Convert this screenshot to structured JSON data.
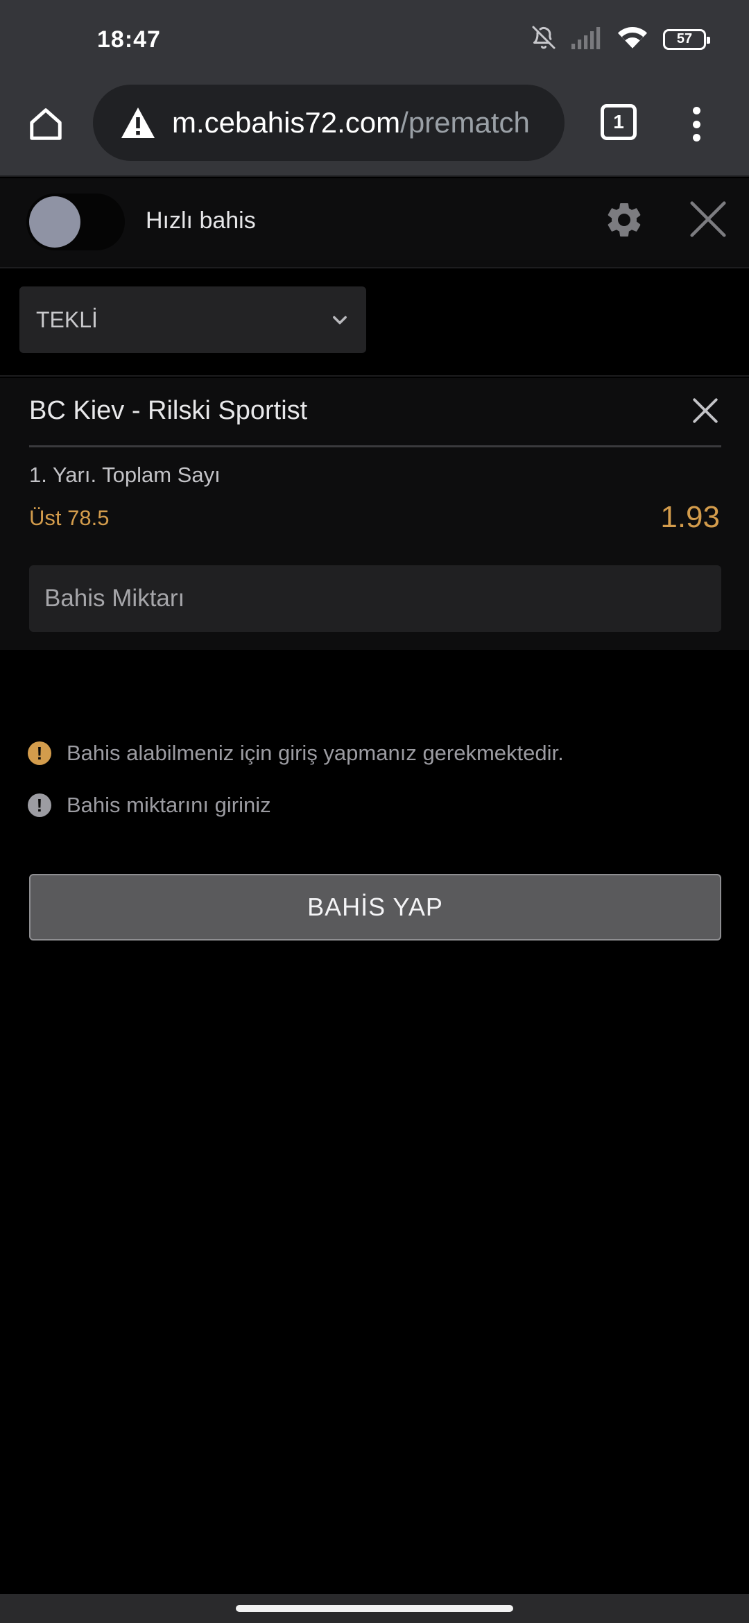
{
  "status_bar": {
    "time": "18:47",
    "battery_level": "57",
    "icons": [
      "bell-off-icon",
      "signal-icon",
      "wifi-icon",
      "battery-icon"
    ]
  },
  "browser": {
    "url_host": "m.cebahis72.com",
    "url_path": "/prematch",
    "tab_count": "1",
    "icons": [
      "home-icon",
      "warning-icon",
      "tabs-icon",
      "more-vert-icon"
    ]
  },
  "betslip": {
    "quick_bet_label": "Hızlı bahis",
    "quick_bet_enabled": false,
    "bet_type": "TEKLİ",
    "bet": {
      "match": "BC Kiev - Rilski Sportist",
      "market": "1. Yarı. Toplam Sayı",
      "selection": "Üst 78.5",
      "odds": "1.93"
    },
    "stake_placeholder": "Bahis Miktarı",
    "messages": [
      {
        "text": "Bahis alabilmeniz için giriş yapmanız gerekmektedir.",
        "icon_color": "#d39c4c",
        "icon": "!"
      },
      {
        "text": "Bahis miktarını giriniz",
        "icon_color": "#9c9ca2",
        "icon": "!"
      }
    ],
    "place_bet_label": "BAHİS YAP"
  },
  "colors": {
    "accent": "#d39c4c",
    "background": "#000000",
    "panel": "#0d0d0e"
  }
}
